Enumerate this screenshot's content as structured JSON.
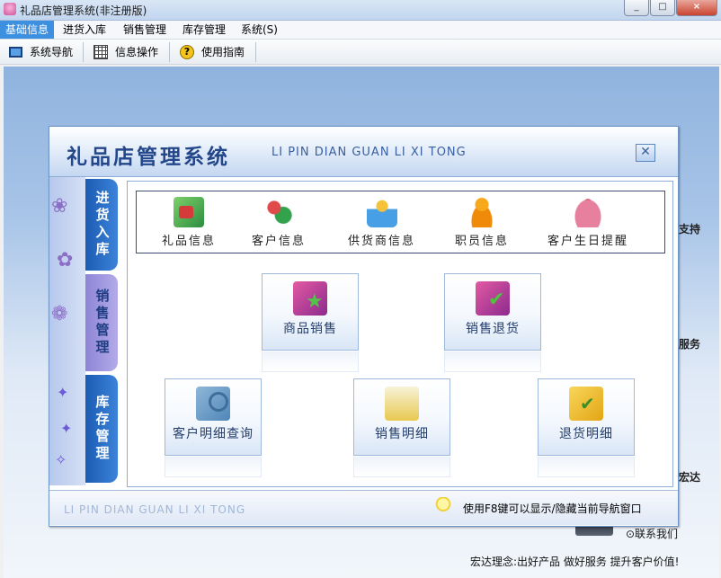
{
  "window": {
    "title": "礼品店管理系统(非注册版)",
    "buttons": [
      "_",
      "□",
      "×"
    ]
  },
  "menu": [
    {
      "label": "基础信息",
      "active": true
    },
    {
      "label": "进货入库"
    },
    {
      "label": "销售管理"
    },
    {
      "label": "库存管理"
    },
    {
      "label": "系统(S)"
    }
  ],
  "toolbar": {
    "nav": "系统导航",
    "ops": "信息操作",
    "guide": "使用指南"
  },
  "nav": {
    "title_cn": "礼品店管理系统",
    "title_en": "LI PIN DIAN GUAN LI XI TONG",
    "close_glyph": "✕",
    "tabs": [
      "进货入库",
      "销售管理",
      "库存管理"
    ],
    "modules": [
      "礼品信息",
      "客户信息",
      "供货商信息",
      "职员信息",
      "客户生日提醒"
    ],
    "actions": [
      "商品销售",
      "销售退货",
      "客户明细查询",
      "销售明细",
      "退货明细"
    ],
    "footer_en": "LI PIN DIAN GUAN LI XI TONG",
    "footer_tip": "使用F8键可以显示/隐藏当前导航窗口"
  },
  "background": {
    "side_labels": [
      "支持",
      "服务",
      "宏达"
    ],
    "contact": "⊙联系我们",
    "slogan": "宏达理念:出好产品 做好服务 提升客户价值!"
  }
}
